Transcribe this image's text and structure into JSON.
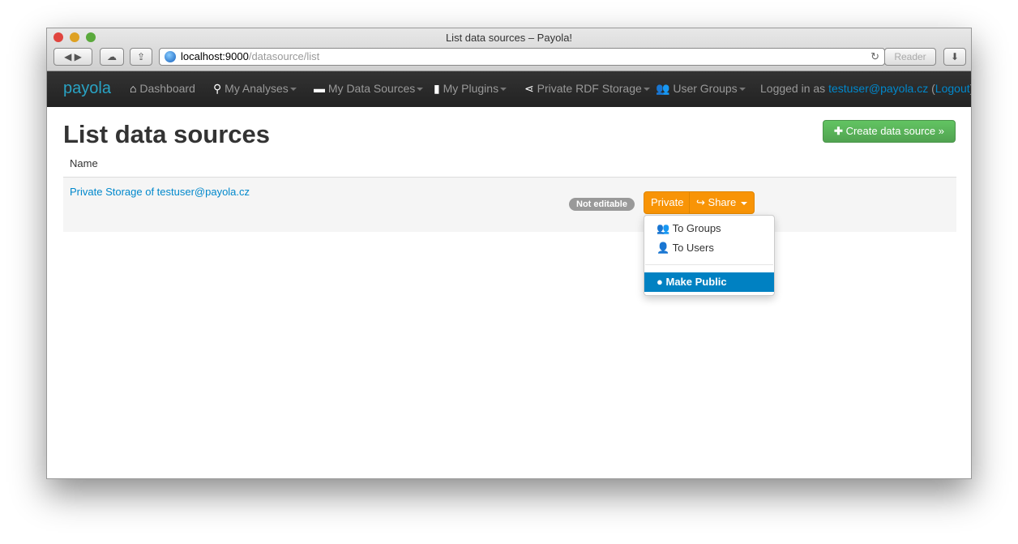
{
  "browser": {
    "title": "List data sources – Payola!",
    "url_host": "localhost:9000",
    "url_path": "/datasource/list",
    "reader": "Reader"
  },
  "nav": {
    "logo": "payola",
    "items": [
      {
        "label": "Dashboard",
        "icon": "home-icon"
      },
      {
        "label": "My Analyses",
        "icon": "search-icon"
      },
      {
        "label": "My Data Sources",
        "icon": "drive-icon"
      },
      {
        "label": "My Plugins",
        "icon": "file-icon"
      },
      {
        "label": "Private RDF Storage",
        "icon": "share-nodes-icon"
      },
      {
        "label": "User Groups",
        "icon": "users-icon"
      }
    ],
    "logged_prefix": "Logged in as ",
    "user": "testuser@payola.cz",
    "logout": "Logout"
  },
  "page": {
    "title": "List data sources",
    "create": "Create data source »",
    "col_name": "Name",
    "rows": [
      {
        "name": "Private Storage of testuser@payola.cz",
        "badge": "Not editable",
        "private": "Private",
        "share": "Share"
      }
    ]
  },
  "share_menu": {
    "items": [
      "To Groups",
      "To Users"
    ],
    "public": "Make Public"
  },
  "colors": {
    "accent": "#0088cc",
    "orange": "#f89406",
    "green": "#51a351",
    "active": "#0081c2"
  }
}
